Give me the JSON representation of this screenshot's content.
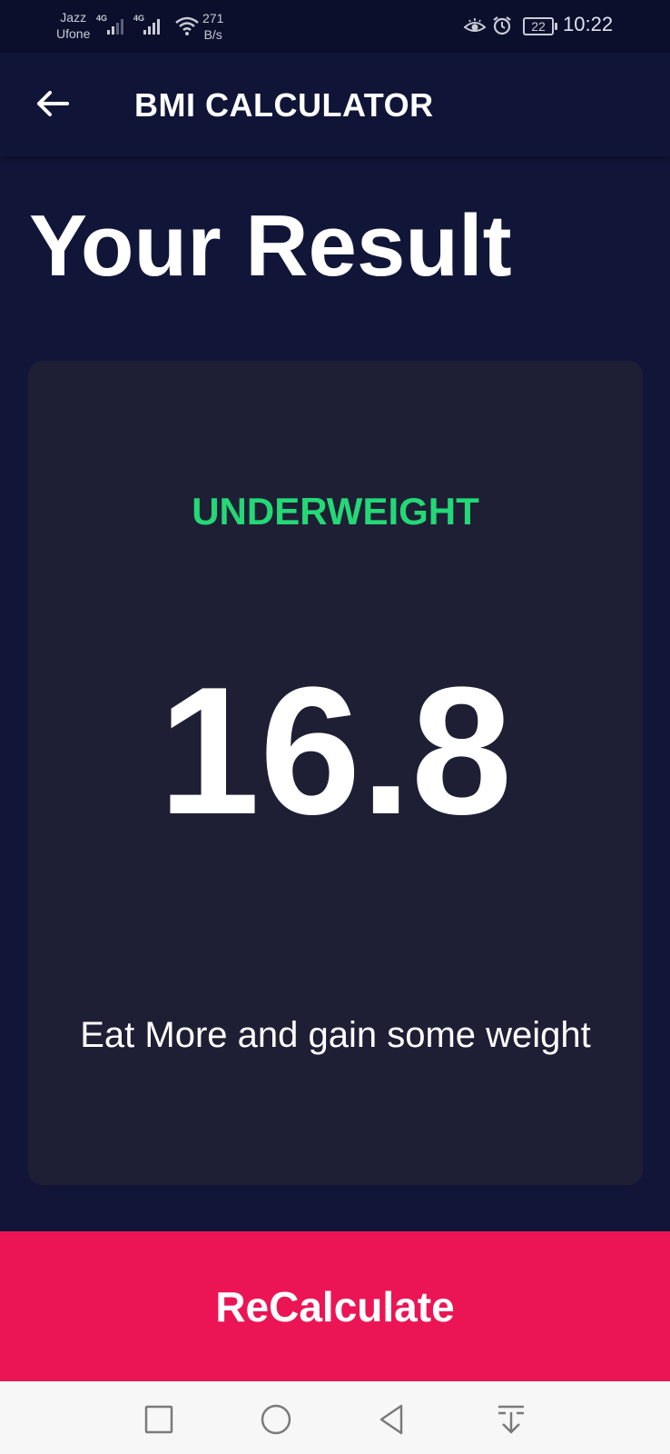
{
  "status_bar": {
    "carrier_1": "Jazz",
    "carrier_2": "Ufone",
    "network_1": "4G",
    "network_2": "4G",
    "net_speed_value": "271",
    "net_speed_unit": "B/s",
    "battery_level": "22",
    "time": "10:22"
  },
  "app_bar": {
    "title": "BMI CALCULATOR",
    "back_icon": "arrow-left-icon"
  },
  "page": {
    "heading": "Your Result"
  },
  "result": {
    "status": "UNDERWEIGHT",
    "status_color": "#24d876",
    "bmi": "16.8",
    "advice": "Eat More and gain some weight"
  },
  "actions": {
    "recalculate_label": "ReCalculate",
    "accent_color": "#eb1555"
  },
  "nav_bar": {
    "icons": [
      "square-icon",
      "circle-icon",
      "triangle-back-icon",
      "download-arrow-icon"
    ]
  }
}
